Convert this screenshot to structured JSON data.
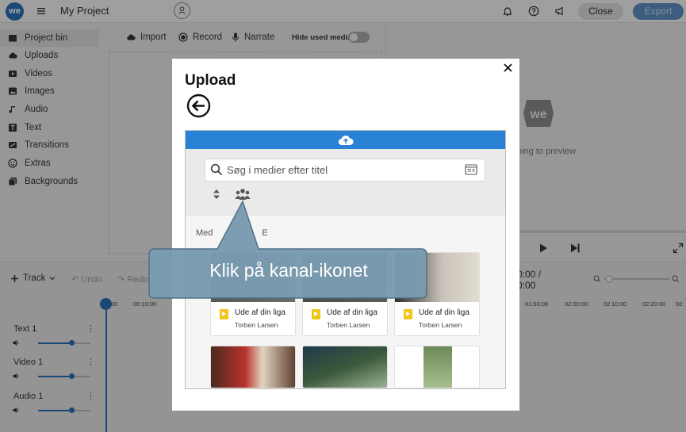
{
  "app": {
    "logo_text": "we",
    "project_title": "My Project",
    "close_label": "Close",
    "export_label": "Export"
  },
  "sidebar": {
    "items": [
      {
        "label": "Project bin",
        "icon": "folder-icon",
        "active": true
      },
      {
        "label": "Uploads",
        "icon": "cloud-icon",
        "active": false
      },
      {
        "label": "Videos",
        "icon": "video-icon",
        "active": false
      },
      {
        "label": "Images",
        "icon": "image-icon",
        "active": false
      },
      {
        "label": "Audio",
        "icon": "music-note-icon",
        "active": false
      },
      {
        "label": "Text",
        "icon": "text-icon",
        "active": false
      },
      {
        "label": "Transitions",
        "icon": "transitions-icon",
        "active": false
      },
      {
        "label": "Extras",
        "icon": "smiley-icon",
        "active": false
      },
      {
        "label": "Backgrounds",
        "icon": "backgrounds-icon",
        "active": false
      }
    ]
  },
  "toolbar": {
    "import_label": "Import",
    "record_label": "Record",
    "narrate_label": "Narrate",
    "hide_used_label": "Hide used media",
    "hide_used_on": false
  },
  "preview": {
    "text_fragment": "ning to preview"
  },
  "timeline": {
    "track_label": "Track",
    "undo_label": "Undo",
    "redo_label": "Redo",
    "time_line1": "0:00 /",
    "time_line2": "0:00",
    "ticks": [
      "00",
      "00:10:00",
      "01:50:00",
      "02:00:00",
      "02:10:00",
      "02:20:00",
      "02:"
    ],
    "tracks": [
      {
        "name": "Text 1"
      },
      {
        "name": "Video 1"
      },
      {
        "name": "Audio 1"
      }
    ]
  },
  "modal": {
    "title": "Upload",
    "search_placeholder": "Søg i medier efter titel",
    "media_label": "Med",
    "media_label_tail": "E",
    "cards": [
      {
        "title": "Ude af din liga",
        "author": "Torben Larsen"
      },
      {
        "title": "Ude af din liga",
        "author": "Torben Larsen"
      },
      {
        "title": "Ude af din liga",
        "author": "Torben Larsen"
      }
    ]
  },
  "callout": {
    "text": "Klik på kanal-ikonet"
  },
  "colors": {
    "brand_blue": "#2a6fb2",
    "upload_bar_blue": "#2a82d6",
    "callout_fill": "#7a9bb0",
    "doc_yellow": "#f0c419"
  }
}
